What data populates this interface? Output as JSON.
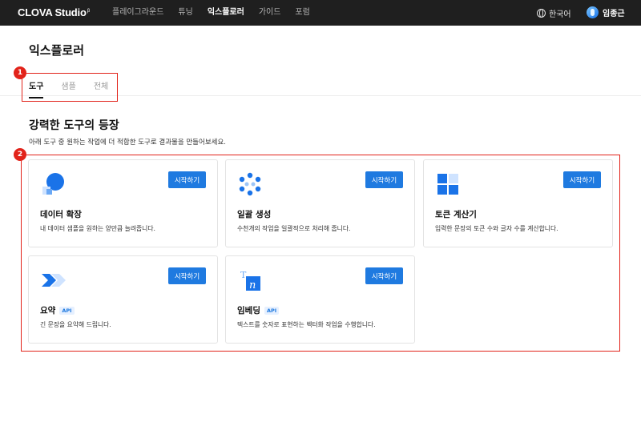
{
  "header": {
    "logo": "CLOVA Studio",
    "logo_mark": "β",
    "nav": [
      "플레이그라운드",
      "튜닝",
      "익스플로러",
      "가이드",
      "포럼"
    ],
    "active_nav": "익스플로러",
    "language": "한국어",
    "user_name": "임종근"
  },
  "page": {
    "title": "익스플로러",
    "tabs": [
      "도구",
      "샘플",
      "전체"
    ]
  },
  "section": {
    "title": "강력한 도구의 등장",
    "description": "아래 도구 중 원하는 작업에 더 적합한 도구로 결과물을 만들어보세요."
  },
  "annotations": {
    "m1": "1",
    "m2": "2"
  },
  "cards": [
    {
      "title": "데이터 확장",
      "desc": "내 데이터 샘플을 원하는 양만큼 늘려줍니다.",
      "button": "시작하기",
      "badge": ""
    },
    {
      "title": "일괄 생성",
      "desc": "수천개의 작업을 일괄적으로 처리해 줍니다.",
      "button": "시작하기",
      "badge": ""
    },
    {
      "title": "토큰 계산기",
      "desc": "입력한 문장의 토큰 수와 글자 수를 계산합니다.",
      "button": "시작하기",
      "badge": ""
    },
    {
      "title": "요약",
      "desc": "긴 문장을 요약해 드립니다.",
      "button": "시작하기",
      "badge": "API"
    },
    {
      "title": "임베딩",
      "desc": "텍스트를 숫자로 표현하는 벡터화 작업을 수행합니다.",
      "button": "시작하기",
      "badge": "API"
    }
  ],
  "colors": {
    "accent": "#1f7ae0",
    "marker": "#e2231a",
    "topbar": "#1f1f1f"
  }
}
